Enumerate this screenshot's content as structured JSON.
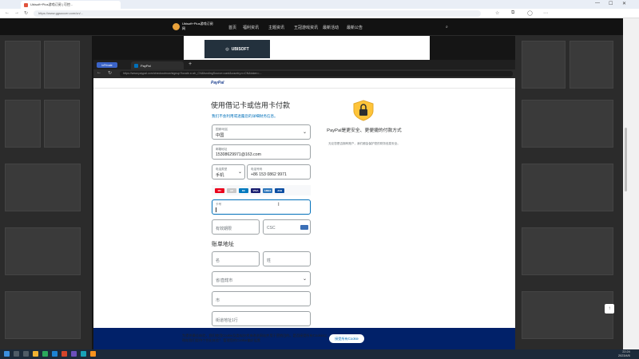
{
  "outer_browser": {
    "tab_title": "Ubisoft+Plus游戏订阅 | 可控...",
    "url": "https://www.ggsoccer.com/cn/...",
    "controls": [
      "—",
      "☐",
      "✕"
    ]
  },
  "site": {
    "logo_text": "Ubisoft+Plus游戏订阅网",
    "nav": [
      "首页",
      "福利资讯",
      "主题资讯",
      "王冠游戏资讯",
      "最新活动",
      "最新公告"
    ],
    "ubisoft_card": "UBISOFT",
    "back_to_top": "↑"
  },
  "popup": {
    "inprivate": "InPrivate",
    "tab_title": "PayPal",
    "url": "https://www.paypal.com/checkoutnow/signup?locale.x=zh_CN&fundingSource=card&country.x=CN&token=...",
    "paypal_logo": "PayPal"
  },
  "form": {
    "title": "使用借记卡或信用卡付款",
    "subtitle": "我们不会利用或透露您的详细财务信息。",
    "country": {
      "label": "国家/地区",
      "value": "中国"
    },
    "email": {
      "label": "邮箱地址",
      "value": "15308629971@163.com"
    },
    "phone_type": {
      "label": "电话类型",
      "value": "手机"
    },
    "phone": {
      "label": "电话号码",
      "value": "+86 153 0862 9971"
    },
    "card_label": "卡号",
    "expiry_ph": "有效期限",
    "csc_ph": "CSC",
    "billing_heading": "账单地址",
    "last_name_ph": "名",
    "first_name_ph": "姓",
    "province_ph": "省/直辖市",
    "city_ph": "市",
    "address_ph": "街道地址1行",
    "cards": [
      "MC",
      "UP",
      "DC",
      "VISA",
      "AMEX",
      "JCB"
    ]
  },
  "security": {
    "title": "PayPal是更安全、更便捷的付款方式",
    "body": "无论您是否拥有账户，我们都会保护您的财务信息安全。"
  },
  "cookie": {
    "text": "为提供最佳体验，我们使用Cookie及类似技术来改进网站并用于营销目的。是否接受所有Cookie以帮助我们提供个性化体验？ 管理您的Cookie偏好设置",
    "button": "接受所有Cookie"
  },
  "taskbar": {
    "time": "22:24",
    "date": "2023/4/5"
  },
  "colors": {
    "paypal_blue": "#0070ba",
    "paypal_navy": "#012169",
    "focus_border": "#0070ba"
  }
}
